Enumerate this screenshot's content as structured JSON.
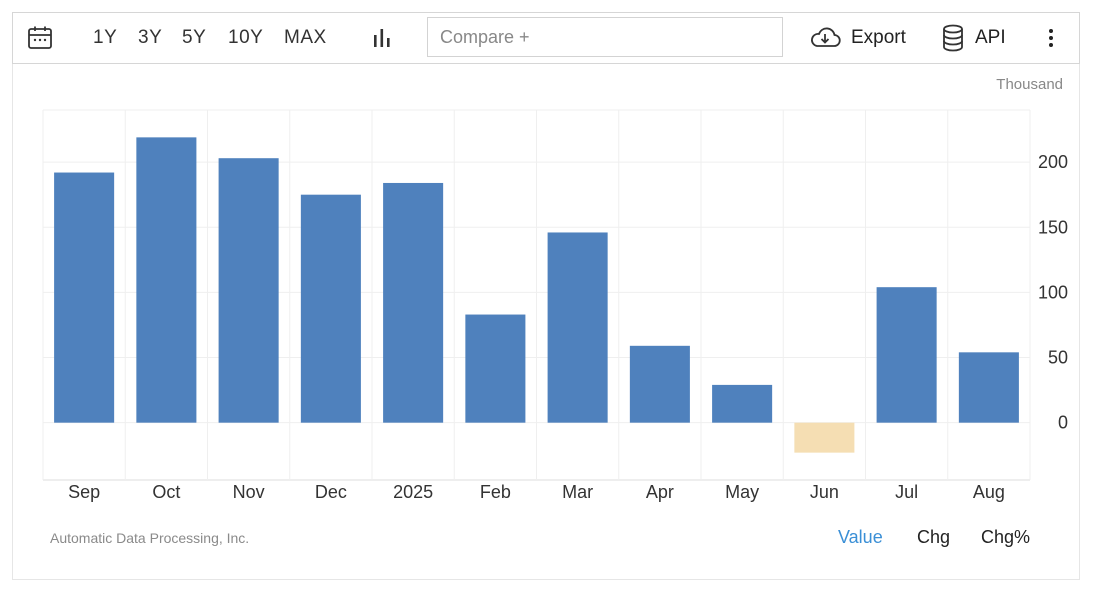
{
  "toolbar": {
    "ranges": [
      "1Y",
      "3Y",
      "5Y",
      "10Y",
      "MAX"
    ],
    "compare_placeholder": "Compare +",
    "export_label": "Export",
    "api_label": "API"
  },
  "footer": {
    "source": "Automatic Data Processing, Inc.",
    "tabs": [
      "Value",
      "Chg",
      "Chg%"
    ],
    "active_tab": "Value"
  },
  "colors": {
    "positive_bar": "#4f81bd",
    "negative_bar": "#f5deb3",
    "grid": "#efefef",
    "active_tab": "#3a8fd6"
  },
  "chart_data": {
    "type": "bar",
    "unit_label": "Thousand",
    "categories": [
      "Sep",
      "Oct",
      "Nov",
      "Dec",
      "2025",
      "Feb",
      "Mar",
      "Apr",
      "May",
      "Jun",
      "Jul",
      "Aug"
    ],
    "values": [
      192,
      219,
      203,
      175,
      184,
      83,
      146,
      59,
      29,
      -23,
      104,
      54
    ],
    "yticks": [
      0,
      50,
      100,
      150,
      200
    ],
    "ylim": [
      -44,
      240
    ],
    "grid": true,
    "y_axis_side": "right"
  }
}
